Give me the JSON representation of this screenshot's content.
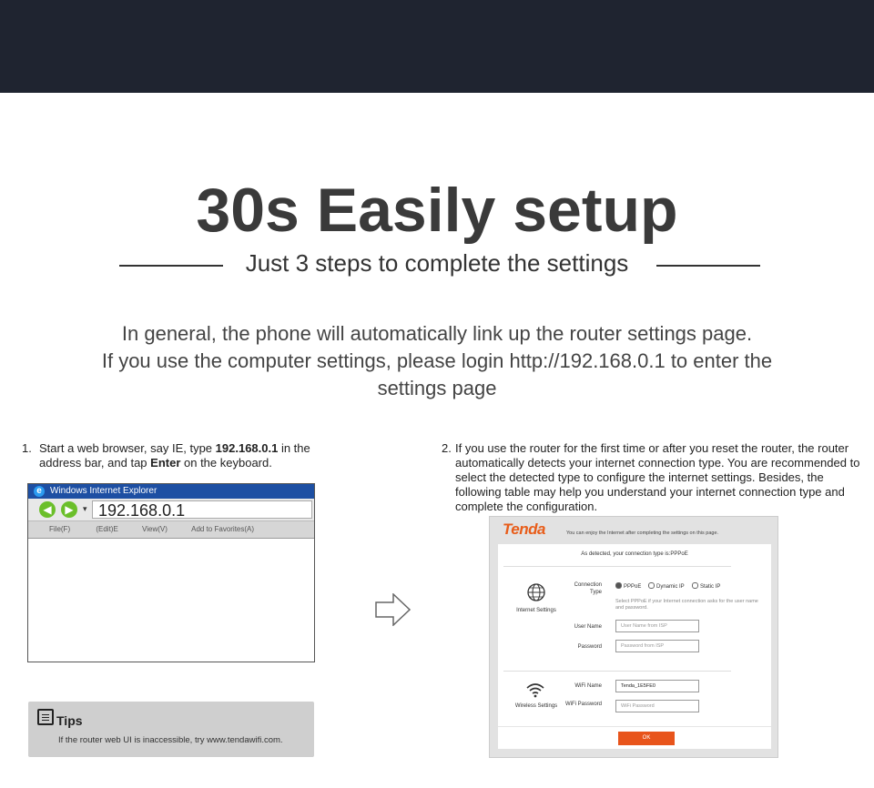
{
  "hero": {
    "title": "30s Easily setup",
    "subtitle": "Just 3 steps to complete the settings",
    "intro_line1": "In general, the phone will automatically link up the router settings page.",
    "intro_line2": "If you use the computer settings, please login http://192.168.0.1 to enter the",
    "intro_line3": "settings page"
  },
  "step1": {
    "number": "1.",
    "text_a": "Start a web browser, say IE, type ",
    "text_b": "192.168.0.1",
    "text_c": " in the address bar, and tap ",
    "text_d": "Enter",
    "text_e": " on the keyboard."
  },
  "browser": {
    "window_title": "Windows Internet Explorer",
    "address": "192.168.0.1",
    "menu": [
      "File(F)",
      "(Edit)E",
      "View(V)",
      "Add to Favorites(A)"
    ]
  },
  "tips": {
    "label": "Tips",
    "text": "If the router web UI is inaccessible, try www.tendawifi.com."
  },
  "step2": {
    "number": "2.",
    "text": "If you use the router for the first time or after you reset the router, the router automatically detects your internet connection type. You are recommended to select the detected type to configure the internet settings. Besides, the following table may help you understand your internet connection type and complete the configuration."
  },
  "tenda": {
    "brand": "Tenda",
    "tagline": "You can enjoy the Internet after completing the settings on this page.",
    "detected": "As detected, your connection type is:PPPoE",
    "internet_section": "Internet Settings",
    "connection_type_label": "Connection Type",
    "options": [
      "PPPoE",
      "Dynamic IP",
      "Static IP"
    ],
    "selected_option": "PPPoE",
    "hint": "Select PPPoE if your Internet connection asks for the user name and password.",
    "username_label": "User Name",
    "username_placeholder": "User Name from ISP",
    "password_label": "Password",
    "password_placeholder": "Password from ISP",
    "wireless_section": "Wireless Settings",
    "wifi_name_label": "WiFi Name",
    "wifi_name_value": "Tenda_1E5FE0",
    "wifi_password_label": "WiFi Password",
    "wifi_password_placeholder": "WiFi Password",
    "ok_label": "OK"
  }
}
